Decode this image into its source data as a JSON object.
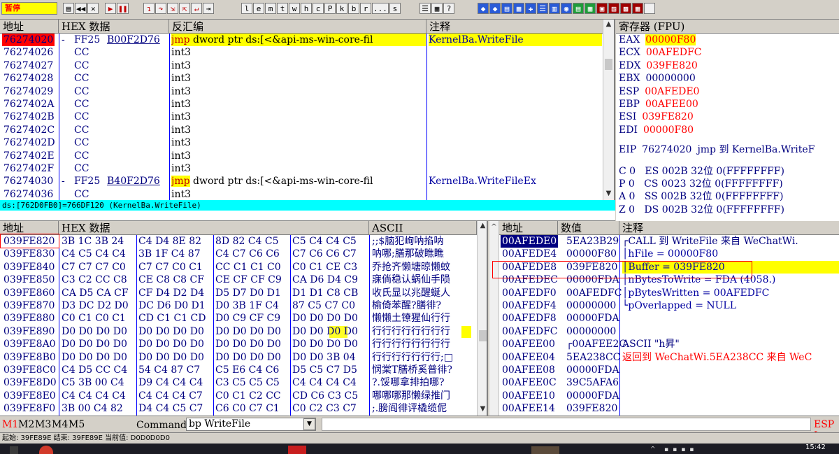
{
  "toolbar": {
    "status": "暂停",
    "letters": [
      "l",
      "e",
      "m",
      "t",
      "w",
      "h",
      "c",
      "P",
      "k",
      "b",
      "r",
      "...",
      "s"
    ]
  },
  "disasm": {
    "headers": {
      "addr": "地址",
      "hex": "HEX 数据",
      "disasm": "反汇编",
      "comment": "注释"
    },
    "rows": [
      {
        "addr": "76274020",
        "mark": "-",
        "hex": "FF25",
        "hex2": "B00F2D76",
        "dis_kw": "jmp",
        "dis": " dword ptr ds:[<&api-ms-win-core-fil",
        "comment": "KernelBa.WriteFile"
      },
      {
        "addr": "76274026",
        "mark": "",
        "hex": "CC",
        "hex2": "",
        "dis_kw": "",
        "dis": "int3",
        "comment": ""
      },
      {
        "addr": "76274027",
        "mark": "",
        "hex": "CC",
        "hex2": "",
        "dis_kw": "",
        "dis": "int3",
        "comment": ""
      },
      {
        "addr": "76274028",
        "mark": "",
        "hex": "CC",
        "hex2": "",
        "dis_kw": "",
        "dis": "int3",
        "comment": ""
      },
      {
        "addr": "76274029",
        "mark": "",
        "hex": "CC",
        "hex2": "",
        "dis_kw": "",
        "dis": "int3",
        "comment": ""
      },
      {
        "addr": "7627402A",
        "mark": "",
        "hex": "CC",
        "hex2": "",
        "dis_kw": "",
        "dis": "int3",
        "comment": ""
      },
      {
        "addr": "7627402B",
        "mark": "",
        "hex": "CC",
        "hex2": "",
        "dis_kw": "",
        "dis": "int3",
        "comment": ""
      },
      {
        "addr": "7627402C",
        "mark": "",
        "hex": "CC",
        "hex2": "",
        "dis_kw": "",
        "dis": "int3",
        "comment": ""
      },
      {
        "addr": "7627402D",
        "mark": "",
        "hex": "CC",
        "hex2": "",
        "dis_kw": "",
        "dis": "int3",
        "comment": ""
      },
      {
        "addr": "7627402E",
        "mark": "",
        "hex": "CC",
        "hex2": "",
        "dis_kw": "",
        "dis": "int3",
        "comment": ""
      },
      {
        "addr": "7627402F",
        "mark": "",
        "hex": "CC",
        "hex2": "",
        "dis_kw": "",
        "dis": "int3",
        "comment": ""
      },
      {
        "addr": "76274030",
        "mark": "-",
        "hex": "FF25",
        "hex2": "B40F2D76",
        "dis_kw": "jmp",
        "dis": " dword ptr ds:[<&api-ms-win-core-fil",
        "comment": "KernelBa.WriteFileEx"
      },
      {
        "addr": "76274036",
        "mark": "",
        "hex": "CC",
        "hex2": "",
        "dis_kw": "",
        "dis": "int3",
        "comment": ""
      }
    ],
    "info": "ds:[762D0FB0]=766DF120 (KernelBa.WriteFile)"
  },
  "registers": {
    "header": "寄存器 (FPU)",
    "regs": [
      {
        "name": "EAX",
        "value": "00000F80",
        "extra": ""
      },
      {
        "name": "ECX",
        "value": "00AFEDFC",
        "extra": ""
      },
      {
        "name": "EDX",
        "value": "039FE820",
        "extra": ""
      },
      {
        "name": "EBX",
        "value": "00000000",
        "extra": ""
      },
      {
        "name": "ESP",
        "value": "00AFEDE0",
        "extra": ""
      },
      {
        "name": "EBP",
        "value": "00AFEE00",
        "extra": ""
      },
      {
        "name": "ESI",
        "value": "039FE820",
        "extra": ""
      },
      {
        "name": "EDI",
        "value": "00000F80",
        "extra": ""
      }
    ],
    "eip": {
      "name": "EIP",
      "value": "76274020",
      "extra": "jmp 到 KernelBa.WriteF"
    },
    "flags": [
      "C 0   ES 002B 32位 0(FFFFFFFF)",
      "P 0   CS 0023 32位 0(FFFFFFFF)",
      "A 0   SS 002B 32位 0(FFFFFFFF)",
      "Z 0   DS 002B 32位 0(FFFFFFFF)"
    ]
  },
  "dump": {
    "headers": {
      "addr": "地址",
      "hex": "HEX 数据",
      "ascii": "ASCII"
    },
    "rows": [
      {
        "addr": "039FE820",
        "hex": [
          "3B 1C 3B 24",
          "C4 D4 8E 82",
          "8D 82 C4 C5",
          "C5 C4 C4 C5"
        ],
        "ascii": ";;$脑犯峋呐掐呐"
      },
      {
        "addr": "039FE830",
        "hex": [
          "C4 C5 C4 C4",
          "3B 1F C4 87",
          "C4 C7 C6 C6",
          "C7 C6 C6 C7"
        ],
        "ascii": "呐哪;膳那破瞧瞧"
      },
      {
        "addr": "039FE840",
        "hex": [
          "C7 C7 C7 C0",
          "C7 C7 C0 C1",
          "CC C1 C1 C0",
          "C0 C1 CE C3"
        ],
        "ascii": "乔抢齐懒塘晾懒蚊"
      },
      {
        "addr": "039FE850",
        "hex": [
          "C3 C2 CC C8",
          "CE C8 C8 CF",
          "CE CF CF C9",
          "CA D6 D4 C9"
        ],
        "ascii": "寐倘稳认蜗仙手陨"
      },
      {
        "addr": "039FE860",
        "hex": [
          "CA D5 CA CF",
          "CF D4 D2 D4",
          "D5 D7 D0 D1",
          "D1 D1 C8 CB"
        ],
        "ascii": "收氏显以兆醒蜒人"
      },
      {
        "addr": "039FE870",
        "hex": [
          "D3 DC D2 D0",
          "DC D6 D0 D1",
          "D0 3B 1F C4",
          "87 C5 C7 C0"
        ],
        "ascii": "榆倚苯醒?膳徘?"
      },
      {
        "addr": "039FE880",
        "hex": [
          "C0 C1 C0 C1",
          "CD C1 C1 CD",
          "D0 C9 CF C9",
          "D0 D0 D0 D0"
        ],
        "ascii": "懒懒土镣猩仙行行"
      },
      {
        "addr": "039FE890",
        "hex": [
          "D0 D0 D0 D0",
          "D0 D0 D0 D0",
          "D0 D0 D0 D0",
          "D0 D0 D0 D0"
        ],
        "ascii": "行行行行行行行行"
      },
      {
        "addr": "039FE8A0",
        "hex": [
          "D0 D0 D0 D0",
          "D0 D0 D0 D0",
          "D0 D0 D0 D0",
          "D0 D0 D0 D0"
        ],
        "ascii": "行行行行行行行行"
      },
      {
        "addr": "039FE8B0",
        "hex": [
          "D0 D0 D0 D0",
          "D0 D0 D0 D0",
          "D0 D0 D0 D0",
          "D0 D0 3B 04"
        ],
        "ascii": "行行行行行行行;□"
      },
      {
        "addr": "039FE8C0",
        "hex": [
          "C4 D5 CC C4",
          "54 C4 87 C7",
          "C5 E6 C4 C6",
          "D5 C5 C7 D5"
        ],
        "ascii": "悯棠T膳桥奚普徘?"
      },
      {
        "addr": "039FE8D0",
        "hex": [
          "C5 3B 00 C4",
          "D9 C4 C4 C4",
          "C3 C5 C5 C5",
          "C4 C4 C4 C4"
        ],
        "ascii": "?.馁哪拿排拍哪?"
      },
      {
        "addr": "039FE8E0",
        "hex": [
          "C4 C4 C4 C4",
          "C4 C4 C4 C7",
          "C0 C1 C2 CC",
          "CD C6 C3 C5"
        ],
        "ascii": "哪哪哪那懒绿推门"
      },
      {
        "addr": "039FE8F0",
        "hex": [
          "3B 00 C4 82",
          "D4 C4 C5 C7",
          "C6 C0 C7 C1",
          "C0 C2 C3 C7"
        ],
        "ascii": ";.膀阎徘评橇缆伲"
      }
    ]
  },
  "stack": {
    "headers": {
      "addr": "地址",
      "value": "数值",
      "comment": "注释"
    },
    "rows": [
      {
        "addr": "00AFEDE0",
        "value": "5EA23B29",
        "comment": "┌CALL 到 WriteFile 来自 WeChatWi."
      },
      {
        "addr": "00AFEDE4",
        "value": "00000F80",
        "comment": "│hFile = 00000F80"
      },
      {
        "addr": "00AFEDE8",
        "value": "039FE820",
        "comment": "│Buffer = 039FE820"
      },
      {
        "addr": "00AFEDEC",
        "value": "00000FDA",
        "comment": "│nBytesToWrite = FDA (4058.)"
      },
      {
        "addr": "00AFEDF0",
        "value": "00AFEDFC",
        "comment": "│pBytesWritten = 00AFEDFC"
      },
      {
        "addr": "00AFEDF4",
        "value": "00000000",
        "comment": "└pOverlapped = NULL"
      },
      {
        "addr": "00AFEDF8",
        "value": "00000FDA",
        "comment": ""
      },
      {
        "addr": "00AFEDFC",
        "value": "00000000",
        "comment": ""
      },
      {
        "addr": "00AFEE00",
        "value": "┌00AFEE2C",
        "comment": "ASCII \"h昇\""
      },
      {
        "addr": "00AFEE04",
        "value": "5EA238CC",
        "comment": "返回到 WeChatWi.5EA238CC 来自 WeC"
      },
      {
        "addr": "00AFEE08",
        "value": "00000FDA",
        "comment": ""
      },
      {
        "addr": "00AFEE0C",
        "value": "39C5AFA6",
        "comment": ""
      },
      {
        "addr": "00AFEE10",
        "value": "00000FDA",
        "comment": ""
      },
      {
        "addr": "00AFEE14",
        "value": "039FE820",
        "comment": ""
      }
    ]
  },
  "command": {
    "tabs": [
      "M1",
      "M2",
      "M3",
      "M4",
      "M5"
    ],
    "label": "Command:",
    "value": "bp WriteFile",
    "right": "ESP I"
  },
  "statusbar": "起始: 39FE89E  结束: 39FE89E  当前值: D0D0D0D0",
  "taskbar": {
    "time": "15:42"
  },
  "colors": {
    "highlight": "#ffff00",
    "select_red": "#ff0000",
    "navy": "#000080",
    "info_bar": "#00ffff"
  }
}
